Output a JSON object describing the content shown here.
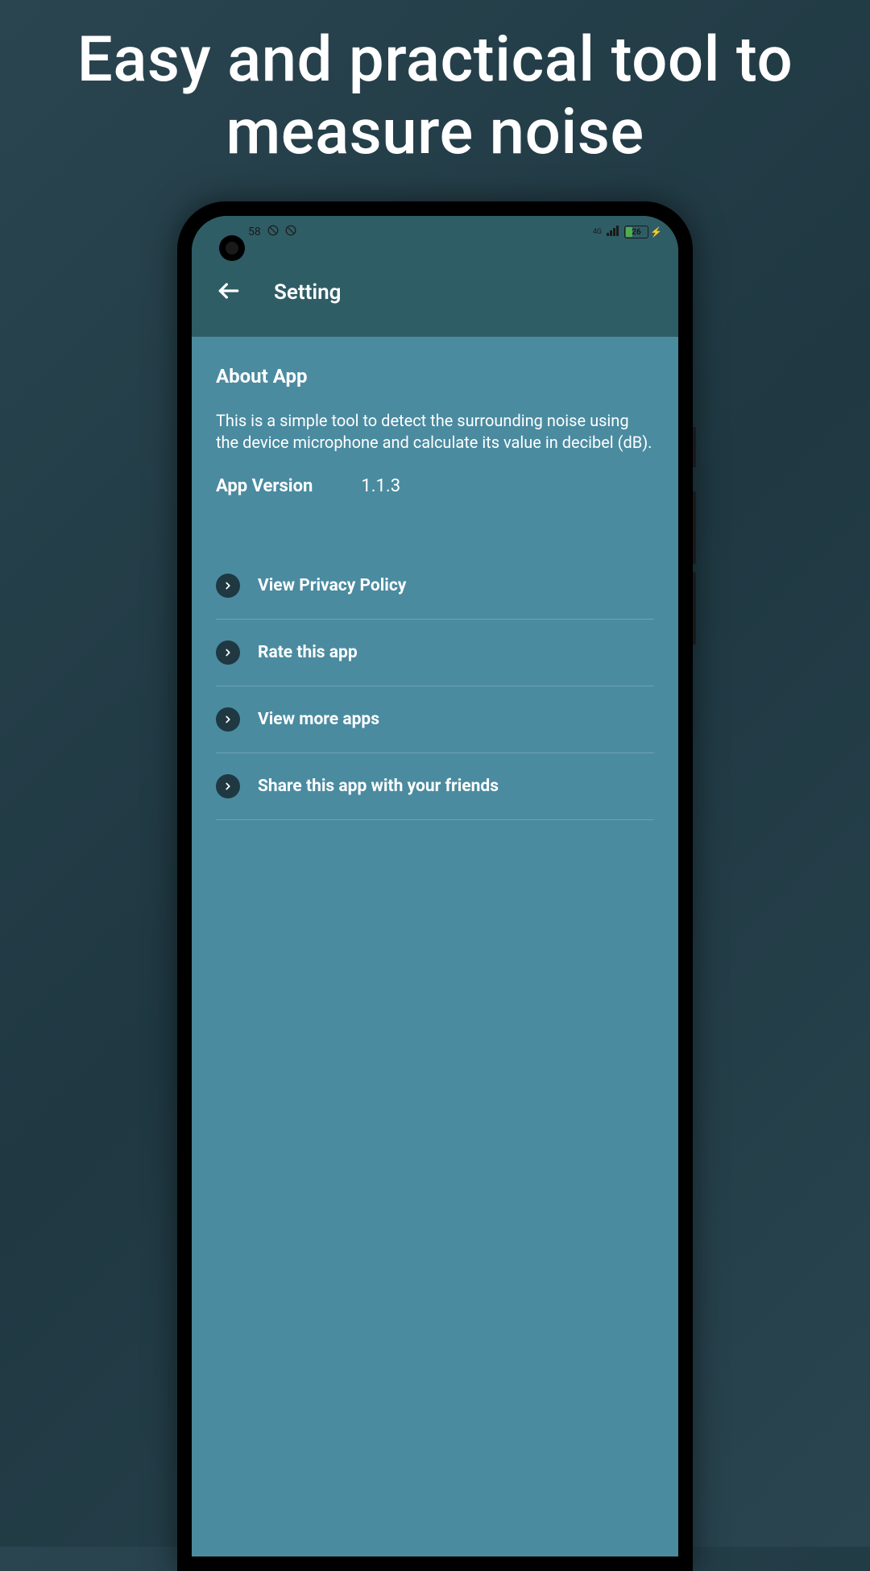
{
  "promo": {
    "title": "Easy and practical tool to measure noise"
  },
  "statusBar": {
    "time": "58",
    "network": "4G",
    "battery": "26"
  },
  "header": {
    "title": "Setting"
  },
  "about": {
    "sectionTitle": "About App",
    "description": "This is a simple tool to detect the surrounding noise using the device microphone and calculate its value in decibel (dB).",
    "versionLabel": "App Version",
    "versionValue": "1.1.3"
  },
  "menu": {
    "items": [
      {
        "label": "View Privacy Policy"
      },
      {
        "label": "Rate this app"
      },
      {
        "label": "View more apps"
      },
      {
        "label": "Share this app with your friends"
      }
    ]
  }
}
